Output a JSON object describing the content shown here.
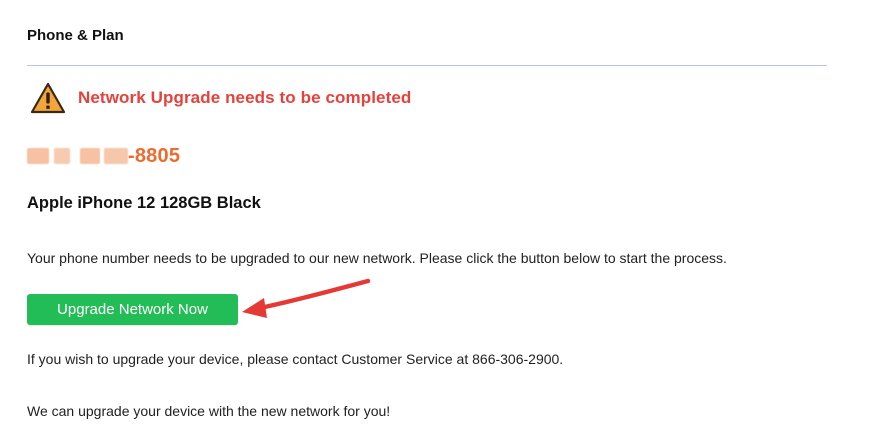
{
  "section": {
    "title": "Phone & Plan"
  },
  "alert": {
    "icon": "warning-triangle-icon",
    "message": "Network Upgrade needs to be completed",
    "color": "#e8403a"
  },
  "phone": {
    "visible_suffix": "-8805",
    "redacted": true,
    "color": "#ee6b2e"
  },
  "device": {
    "name": "Apple iPhone 12 128GB Black"
  },
  "messages": {
    "upgrade_instruction": "Your phone number needs to be upgraded to our new network. Please click the button below to start the process.",
    "device_upgrade_contact": "If you wish to upgrade your device, please contact Customer Service at 866-306-2900.",
    "device_upgrade_offer": "We can upgrade your device with the new network for you!"
  },
  "actions": {
    "upgrade_button_label": "Upgrade Network Now",
    "upgrade_button_color": "#23bd58"
  },
  "annotation": {
    "icon": "red-arrow-icon",
    "color": "#e53935"
  }
}
